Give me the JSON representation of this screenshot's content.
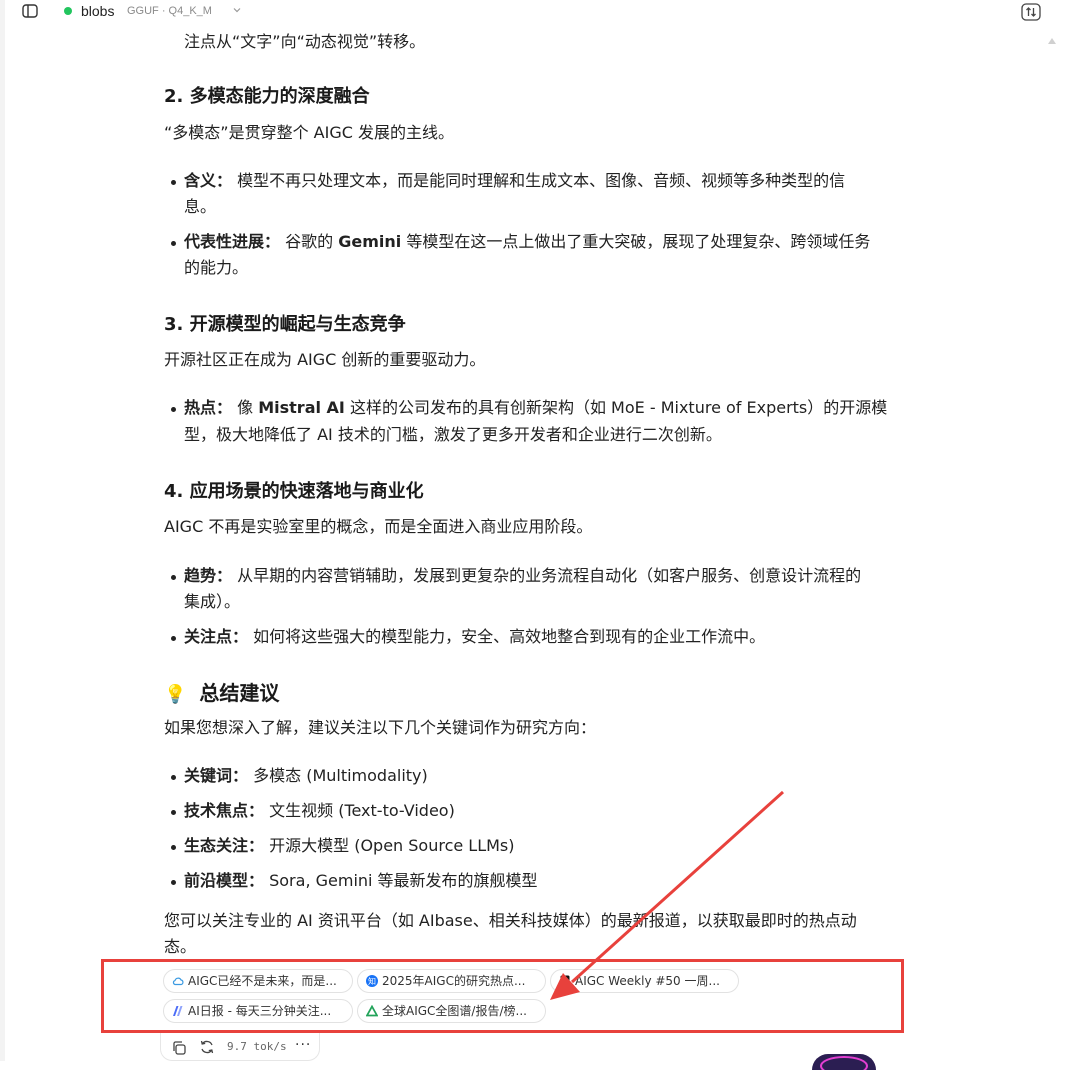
{
  "header": {
    "model_name": "blobs",
    "model_quant": "GGUF · Q4_K_M",
    "status_color": "#22c55e"
  },
  "content": {
    "intro_tail": "注点从“文字”向“动态视觉”转移。",
    "s2": {
      "heading": "2. 多模态能力的深度融合",
      "para": "“多模态”是贯穿整个 AIGC 发展的主线。",
      "b1_label": "含义：",
      "b1_line1": "模型不再只处理文本，而是能同时理解和生成文本、图像、音频、视频等多种类型的信",
      "b1_line2": "息。",
      "b2_label": "代表性进展：",
      "b2_pre": "谷歌的",
      "b2_bold": "Gemini",
      "b2_line1_rest": "等模型在这一点上做出了重大突破，展现了处理复杂、跨领域任务",
      "b2_line2": "的能力。"
    },
    "s3": {
      "heading": "3. 开源模型的崛起与生态竞争",
      "para": "开源社区正在成为 AIGC 创新的重要驱动力。",
      "b1_label": "热点：",
      "b1_pre": "像",
      "b1_bold": "Mistral AI",
      "b1_line1_rest": "这样的公司发布的具有创新架构（如 MoE - Mixture of Experts）的开源模",
      "b1_line2": "型，极大地降低了 AI 技术的门槛，激发了更多开发者和企业进行二次创新。"
    },
    "s4": {
      "heading": "4. 应用场景的快速落地与商业化",
      "para": "AIGC 不再是实验室里的概念，而是全面进入商业应用阶段。",
      "b1_label": "趋势：",
      "b1_line1": "从早期的内容营销辅助，发展到更复杂的业务流程自动化（如客户服务、创意设计流程的",
      "b1_line2": "集成）。",
      "b2_label": "关注点：",
      "b2_text": "如何将这些强大的模型能力，安全、高效地整合到现有的企业工作流中。"
    },
    "summary": {
      "icon": "💡",
      "heading": "总结建议",
      "para": "如果您想深入了解，建议关注以下几个关键词作为研究方向：",
      "items": [
        {
          "label": "关键词：",
          "text": "多模态 (Multimodality)"
        },
        {
          "label": "技术焦点：",
          "text": "文生视频 (Text-to-Video)"
        },
        {
          "label": "生态关注：",
          "text": "开源大模型 (Open Source LLMs)"
        },
        {
          "label": "前沿模型：",
          "text": "Sora, Gemini 等最新发布的旗舰模型"
        }
      ],
      "closing_line1": "您可以关注专业的 AI 资讯平台（如 AIbase、相关科技媒体）的最新报道，以获取最即时的热点动",
      "closing_line2": "态。"
    }
  },
  "sources": [
    {
      "label": "AIGC已经不是未来，而是...",
      "icon": "cloud-icon",
      "color": "#3b9ae1"
    },
    {
      "label": "2025年AIGC的研究热点...",
      "icon": "zhihu-icon",
      "color": "#1772f6"
    },
    {
      "label": "AIGC Weekly #50 一周...",
      "icon": "doc-icon",
      "color": "#111111"
    },
    {
      "label": "AI日报 - 每天三分钟关注...",
      "icon": "aibase-icon",
      "color": "#4b6cf7"
    },
    {
      "label": "全球AIGC全图谱/报告/榜...",
      "icon": "triangle-icon",
      "color": "#22a35a"
    }
  ],
  "actions": {
    "speed": "9.7 tok/s",
    "more": "···"
  },
  "annotation_color": "#e8413c"
}
